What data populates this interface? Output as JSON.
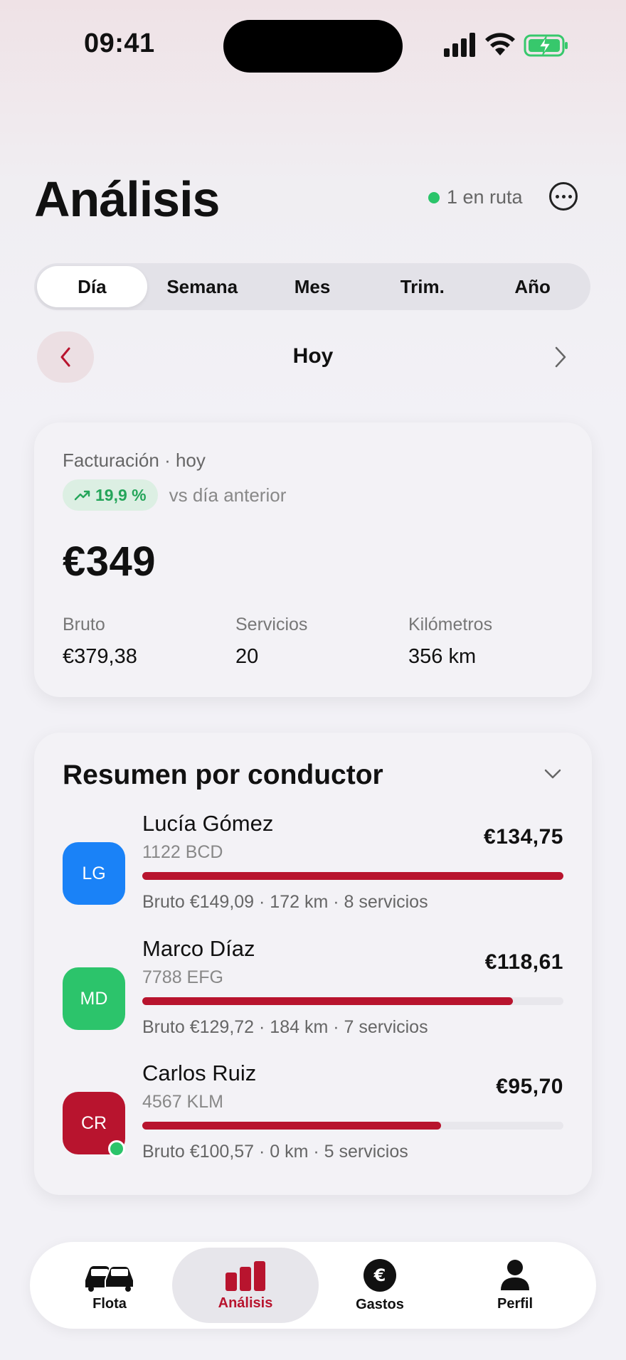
{
  "status_bar": {
    "time": "09:41"
  },
  "header": {
    "title": "Análisis",
    "live_status": "1 en ruta"
  },
  "periods": {
    "tabs": [
      "Día",
      "Semana",
      "Mes",
      "Trim.",
      "Año"
    ],
    "selected": "Día"
  },
  "date_nav": {
    "label": "Hoy"
  },
  "revenue_card": {
    "label": "Facturación · hoy",
    "trend_badge": "19,9 %",
    "trend_caption": "vs día anterior",
    "total": "€349",
    "stats": [
      {
        "label": "Bruto",
        "value": "€379,38"
      },
      {
        "label": "Servicios",
        "value": "20"
      },
      {
        "label": "Kilómetros",
        "value": "356 km"
      }
    ]
  },
  "drivers_card": {
    "title": "Resumen por conductor",
    "drivers": [
      {
        "initials": "LG",
        "name": "Lucía Gómez",
        "plate": "1122 BCD",
        "amount": "€134,75",
        "share": 1.0,
        "meta": "Bruto €149,09 · 172 km · 8 servicios",
        "color": "#1a82f7",
        "online": false
      },
      {
        "initials": "MD",
        "name": "Marco Díaz",
        "plate": "7788 EFG",
        "amount": "€118,61",
        "share": 0.88,
        "meta": "Bruto €129,72 · 184 km · 7 servicios",
        "color": "#2cc46b",
        "online": false
      },
      {
        "initials": "CR",
        "name": "Carlos Ruiz",
        "plate": "4567 KLM",
        "amount": "€95,70",
        "share": 0.71,
        "meta": "Bruto €100,57 · 0 km · 5 servicios",
        "color": "#b8142e",
        "online": true
      }
    ]
  },
  "tab_bar": {
    "items": [
      {
        "label": "Flota",
        "icon": "car-icon"
      },
      {
        "label": "Análisis",
        "icon": "bar-chart-icon"
      },
      {
        "label": "Gastos",
        "icon": "euro-icon"
      },
      {
        "label": "Perfil",
        "icon": "person-icon"
      }
    ],
    "active": "Análisis"
  },
  "colors": {
    "accent": "#b8142e",
    "success": "#2bc46a"
  }
}
